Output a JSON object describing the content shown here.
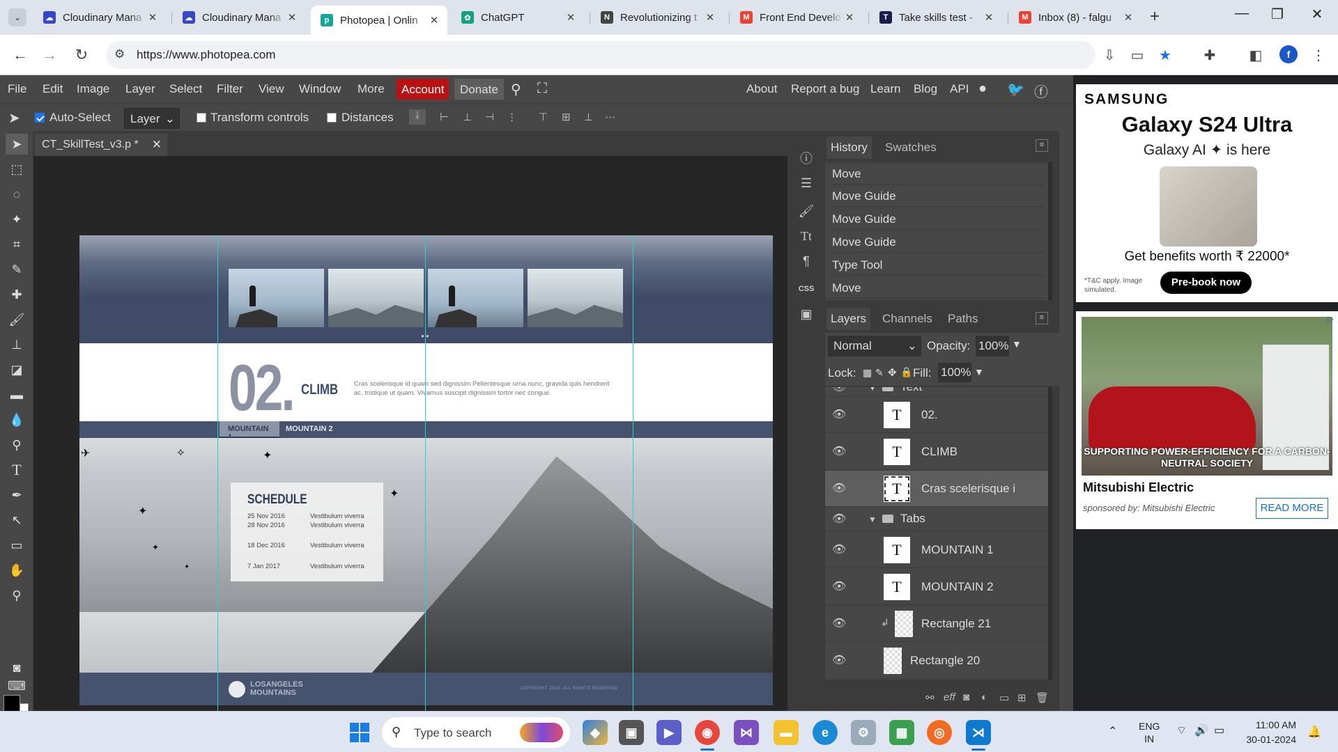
{
  "browser": {
    "tabs": [
      {
        "title": "Cloudinary Mana",
        "icon": "cloudinary-icon",
        "color": "#3448c5"
      },
      {
        "title": "Cloudinary Mana",
        "icon": "cloudinary-icon",
        "color": "#3448c5"
      },
      {
        "title": "Photopea | Onlin",
        "icon": "photopea-icon",
        "color": "#18a497",
        "active": true
      },
      {
        "title": "ChatGPT",
        "icon": "chatgpt-icon",
        "color": "#10a37f"
      },
      {
        "title": "Revolutionizing t",
        "icon": "news-icon",
        "color": "#444444"
      },
      {
        "title": "Front End Develo",
        "icon": "gmail-icon",
        "color": "#ea4335"
      },
      {
        "title": "Take skills test -",
        "icon": "testgorilla-icon",
        "color": "#1c1c4c"
      },
      {
        "title": "Inbox (8) - falgu",
        "icon": "gmail-icon",
        "color": "#ea4335"
      }
    ],
    "url": "https://www.photopea.com",
    "profile_initial": "f"
  },
  "photopea": {
    "menu": [
      "File",
      "Edit",
      "Image",
      "Layer",
      "Select",
      "Filter",
      "View",
      "Window",
      "More"
    ],
    "account_label": "Account",
    "donate_label": "Donate",
    "right_links": [
      "About",
      "Report a bug",
      "Learn",
      "Blog",
      "API"
    ],
    "options": {
      "auto_select_label": "Auto-Select",
      "auto_select_checked": true,
      "layer_select_value": "Layer",
      "transform_label": "Transform controls",
      "distances_label": "Distances"
    },
    "document_tab": "CT_SkillTest_v3.p *",
    "design": {
      "big_number": "02.",
      "heading": "CLIMB",
      "lorem": "Cras scelerisque id quam sed dignissim Pellentesque urna nunc, gravida quis hendrerit ac, tristique ut quam. Vivamus suscipit dignissim tortor nec congue.",
      "tab1": "MOUNTAIN 1",
      "tab2": "MOUNTAIN 2",
      "schedule_title": "SCHEDULE",
      "schedule": [
        {
          "date": "25 Nov 2016",
          "text": "Vestibulum viverra"
        },
        {
          "date": "28 Nov 2016",
          "text": "Vestibulum viverra"
        },
        {
          "date": "18 Dec 2016",
          "text": "Vestibulum viverra"
        },
        {
          "date": "7 Jan 2017",
          "text": "Vestibulum viverra"
        }
      ],
      "logo_line1": "LOSANGELES",
      "logo_line2": "MOUNTAINS",
      "copyright": "COPYRIGHT 2016. ALL RIGHTS RESERVED"
    },
    "history_panel": {
      "tabs": [
        "History",
        "Swatches"
      ],
      "items": [
        "Move",
        "Move Guide",
        "Move Guide",
        "Move Guide",
        "Type Tool",
        "Move"
      ]
    },
    "layers_panel": {
      "tabs": [
        "Layers",
        "Channels",
        "Paths"
      ],
      "blend_mode": "Normal",
      "opacity_label": "Opacity:",
      "opacity": "100%",
      "lock_label": "Lock:",
      "fill_label": "Fill:",
      "fill": "100%",
      "layers": [
        {
          "name": "Text",
          "kind": "group"
        },
        {
          "name": "02.",
          "kind": "text"
        },
        {
          "name": "CLIMB",
          "kind": "text"
        },
        {
          "name": "Cras scelerisque id",
          "kind": "text",
          "selected": true
        },
        {
          "name": "Tabs",
          "kind": "group"
        },
        {
          "name": "MOUNTAIN 1",
          "kind": "text"
        },
        {
          "name": "MOUNTAIN 2",
          "kind": "text"
        },
        {
          "name": "Rectangle 21",
          "kind": "shape"
        },
        {
          "name": "Rectangle 20",
          "kind": "shape"
        }
      ]
    },
    "strip_labels": {
      "css": "CSS"
    }
  },
  "ads": {
    "samsung": {
      "brand": "SAMSUNG",
      "headline": "Galaxy S24 Ultra",
      "sub": "Galaxy AI ✦ is here",
      "benefit": "Get benefits worth ₹ 22000*",
      "tc": "*T&C apply. Image simulated.",
      "button": "Pre-book now"
    },
    "mitsubishi": {
      "banner": "SUPPORTING POWER-EFFICIENCY FOR A CARBON-NEUTRAL SOCIETY",
      "title": "Mitsubishi Electric",
      "sponsored": "sponsored by: Mitsubishi Electric",
      "button": "READ MORE"
    }
  },
  "taskbar": {
    "search_placeholder": "Type to search",
    "lang1": "ENG",
    "lang2": "IN",
    "time": "11:00 AM",
    "date": "30-01-2024"
  }
}
